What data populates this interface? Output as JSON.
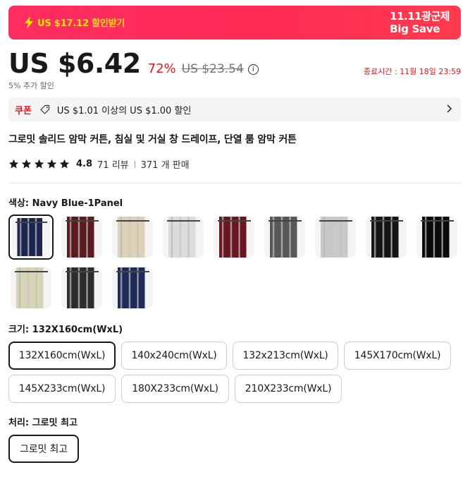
{
  "banner": {
    "coupon_text": "US $17.12 할인받기",
    "sale_line1": "11.11광군제",
    "sale_line2": "Big Save",
    "icon": "lightning-bolt-icon"
  },
  "price": {
    "current": "US $6.42",
    "discount": "72%",
    "original": "US $23.54",
    "end_time": "종료시간 : 11월 18일 23:59",
    "extra_discount": "5% 추가 할인"
  },
  "coupon": {
    "label": "쿠폰",
    "text": "US $1.01 이상의 US $1.00 할인"
  },
  "product": {
    "title": "그로밋 솔리드 암막 커튼, 침실 및 거실 창 드레이프, 단열 룸 암막 커튼",
    "rating": "4.8",
    "stars": 5,
    "reviews": "71 리뷰",
    "sold": "371 개 판매"
  },
  "color": {
    "label": "색상: ",
    "value": "Navy Blue-1Panel",
    "options": [
      {
        "name": "Navy Blue",
        "color": "#1c2550"
      },
      {
        "name": "Wine Red",
        "color": "#5a1a1f"
      },
      {
        "name": "Beige",
        "color": "#ddd2b8"
      },
      {
        "name": "Light Grey",
        "color": "#dcdcdc"
      },
      {
        "name": "Burgundy",
        "color": "#6a1620"
      },
      {
        "name": "Dark Grey",
        "color": "#585858"
      },
      {
        "name": "Silver",
        "color": "#c9c9cc"
      },
      {
        "name": "Black",
        "color": "#151515"
      },
      {
        "name": "Black Solid",
        "color": "#0a0a0a"
      },
      {
        "name": "Cream",
        "color": "#d8d4b6"
      },
      {
        "name": "Charcoal",
        "color": "#2c2c2c"
      },
      {
        "name": "Navy",
        "color": "#1d2a5a"
      }
    ]
  },
  "size": {
    "label": "크기: ",
    "value": "132X160cm(WxL)",
    "options": [
      "132X160cm(WxL)",
      "140x240cm(WxL)",
      "132x213cm(WxL)",
      "145X170cm(WxL)",
      "145X233cm(WxL)",
      "180X233cm(WxL)",
      "210X233cm(WxL)"
    ]
  },
  "treatment": {
    "label": "처리: ",
    "value": "그로밋 최고",
    "options": [
      "그로밋 최고"
    ]
  }
}
